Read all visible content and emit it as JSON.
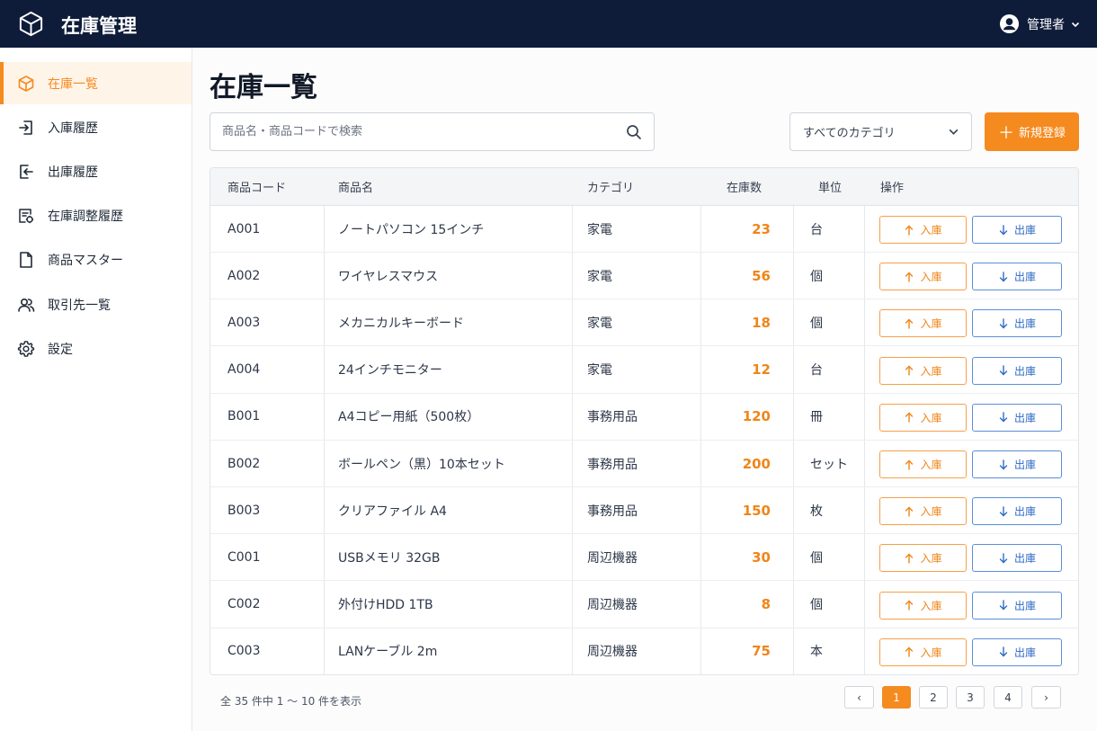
{
  "app": {
    "title": "在庫管理"
  },
  "user": {
    "name": "管理者"
  },
  "sidebar": {
    "items": [
      {
        "label": "在庫一覧",
        "icon": "box-icon",
        "active": true
      },
      {
        "label": "入庫履歴",
        "icon": "login-icon"
      },
      {
        "label": "出庫履歴",
        "icon": "logout-icon"
      },
      {
        "label": "在庫調整履歴",
        "icon": "adjust-document-icon"
      },
      {
        "label": "商品マスター",
        "icon": "document-icon"
      },
      {
        "label": "取引先一覧",
        "icon": "users-icon"
      },
      {
        "label": "設定",
        "icon": "gear-icon"
      }
    ]
  },
  "main": {
    "title": "在庫一覧",
    "search_placeholder": "商品名・商品コードで検索",
    "category_selected": "すべてのカテゴリ",
    "new_button": "新規登録"
  },
  "table": {
    "headers": [
      "商品コード",
      "商品名",
      "カテゴリ",
      "在庫数",
      "単位",
      "操作"
    ],
    "in_label": "入庫",
    "out_label": "出庫",
    "rows": [
      {
        "code": "A001",
        "name": "ノートパソコン 15インチ",
        "category": "家電",
        "qty": "23",
        "unit": "台"
      },
      {
        "code": "A002",
        "name": "ワイヤレスマウス",
        "category": "家電",
        "qty": "56",
        "unit": "個"
      },
      {
        "code": "A003",
        "name": "メカニカルキーボード",
        "category": "家電",
        "qty": "18",
        "unit": "個"
      },
      {
        "code": "A004",
        "name": "24インチモニター",
        "category": "家電",
        "qty": "12",
        "unit": "台"
      },
      {
        "code": "B001",
        "name": "A4コピー用紙（500枚）",
        "category": "事務用品",
        "qty": "120",
        "unit": "冊"
      },
      {
        "code": "B002",
        "name": "ボールペン（黒）10本セット",
        "category": "事務用品",
        "qty": "200",
        "unit": "セット"
      },
      {
        "code": "B003",
        "name": "クリアファイル A4",
        "category": "事務用品",
        "qty": "150",
        "unit": "枚"
      },
      {
        "code": "C001",
        "name": "USBメモリ 32GB",
        "category": "周辺機器",
        "qty": "30",
        "unit": "個"
      },
      {
        "code": "C002",
        "name": "外付けHDD 1TB",
        "category": "周辺機器",
        "qty": "8",
        "unit": "個"
      },
      {
        "code": "C003",
        "name": "LANケーブル 2m",
        "category": "周辺機器",
        "qty": "75",
        "unit": "本"
      }
    ]
  },
  "pagination": {
    "summary": "全 35 件中 1 〜 10 件を表示",
    "prev": "‹",
    "next": "›",
    "pages": [
      "1",
      "2",
      "3",
      "4"
    ],
    "current": "1"
  },
  "colors": {
    "accent": "#f58a1f",
    "header_bg": "#0e1c3a",
    "out_blue": "#2f6bc4"
  }
}
